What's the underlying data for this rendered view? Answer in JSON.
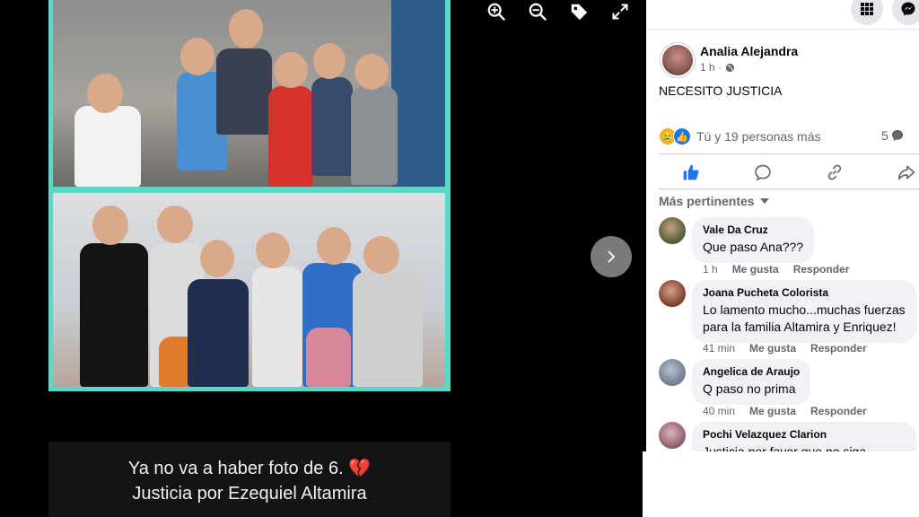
{
  "viewer": {
    "tools": [
      {
        "icon": "zoom-in-icon"
      },
      {
        "icon": "zoom-out-icon"
      },
      {
        "icon": "tag-icon"
      },
      {
        "icon": "fullscreen-icon"
      }
    ],
    "next_icon": "chevron-right-icon",
    "caption_line1": "Ya no va a haber foto de 6.",
    "caption_heart": "💔",
    "caption_line2": "Justicia por Ezequiel Altamira",
    "accent_color": "#5ad8c6"
  },
  "header": {
    "menu_icon": "grid-menu-icon",
    "messenger_icon": "messenger-icon"
  },
  "post": {
    "author": "Analia Alejandra",
    "time": "1 h ·",
    "privacy_icon": "globe-icon",
    "text": "NECESITO JUSTICIA",
    "reactions_text": "Tú y 19 personas más",
    "reaction_icons": [
      "sad-reaction-icon",
      "like-reaction-icon"
    ],
    "comment_count": "5",
    "actions": [
      {
        "icon": "like-icon",
        "active": true
      },
      {
        "icon": "comment-icon",
        "active": false
      },
      {
        "icon": "share-link-icon",
        "active": false
      },
      {
        "icon": "share-icon",
        "active": false
      }
    ],
    "sort_label": "Más pertinentes"
  },
  "comments": [
    {
      "name": "Vale Da Cruz",
      "text": "Que paso Ana???",
      "time": "1 h",
      "like": "Me gusta",
      "reply": "Responder",
      "avatar_color": "#4a5a3a"
    },
    {
      "name": "Joana Pucheta Colorista",
      "text": "Lo lamento mucho...muchas fuerzas para la familia Altamira y Enriquez!",
      "time": "41 min",
      "like": "Me gusta",
      "reply": "Responder",
      "avatar_color": "#7a3b2e"
    },
    {
      "name": "Angelica de Araujo",
      "text": "Q paso no prima",
      "time": "40 min",
      "like": "Me gusta",
      "reply": "Responder",
      "avatar_color": "#6c7a8a"
    },
    {
      "name": "Pochi Velazquez Clarion",
      "text": "Justicia por favor que no siga",
      "time": "",
      "like": "",
      "reply": "",
      "avatar_color": "#8a5a6a"
    }
  ]
}
